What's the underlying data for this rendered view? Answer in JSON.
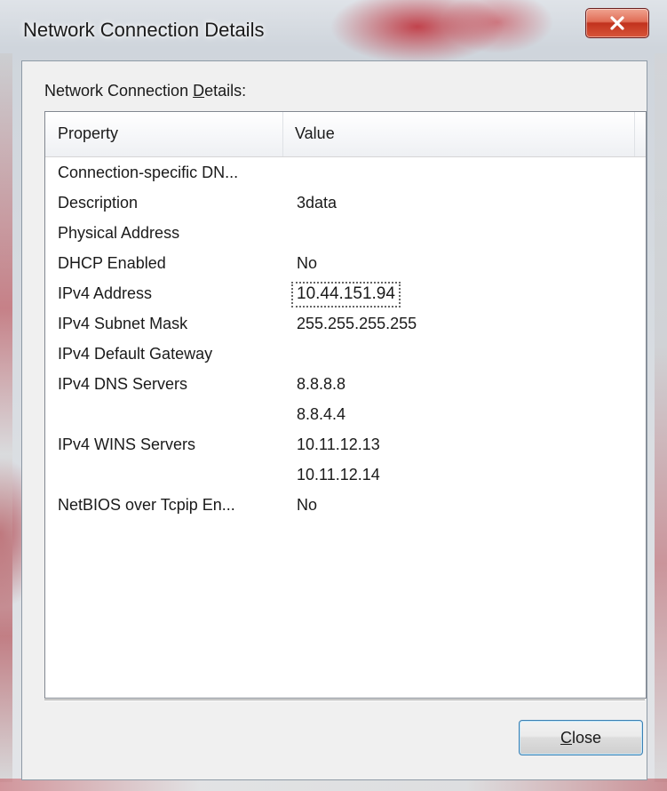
{
  "window": {
    "title": "Network Connection Details",
    "close_glyph": "x-icon"
  },
  "group": {
    "label_prefix": "Network Connection ",
    "label_access": "D",
    "label_suffix": "etails:"
  },
  "table": {
    "columns": [
      "Property",
      "Value"
    ],
    "rows": [
      {
        "property": "Connection-specific DN...",
        "value": ""
      },
      {
        "property": "Description",
        "value": "3data"
      },
      {
        "property": "Physical Address",
        "value": ""
      },
      {
        "property": "DHCP Enabled",
        "value": "No"
      },
      {
        "property": "IPv4 Address",
        "value": "10.44.151.94"
      },
      {
        "property": "IPv4 Subnet Mask",
        "value": "255.255.255.255"
      },
      {
        "property": "IPv4 Default Gateway",
        "value": ""
      },
      {
        "property": "IPv4 DNS Servers",
        "value": "8.8.8.8"
      },
      {
        "property": "",
        "value": "8.8.4.4"
      },
      {
        "property": "IPv4 WINS Servers",
        "value": "10.11.12.13"
      },
      {
        "property": "",
        "value": "10.11.12.14"
      },
      {
        "property": "NetBIOS over Tcpip En...",
        "value": "No"
      }
    ],
    "focused_row": 4
  },
  "buttons": {
    "close_access": "C",
    "close_rest": "lose"
  },
  "colors": {
    "close_x_button": "#d04a33",
    "focus_button_border": "#3c7fb1"
  }
}
